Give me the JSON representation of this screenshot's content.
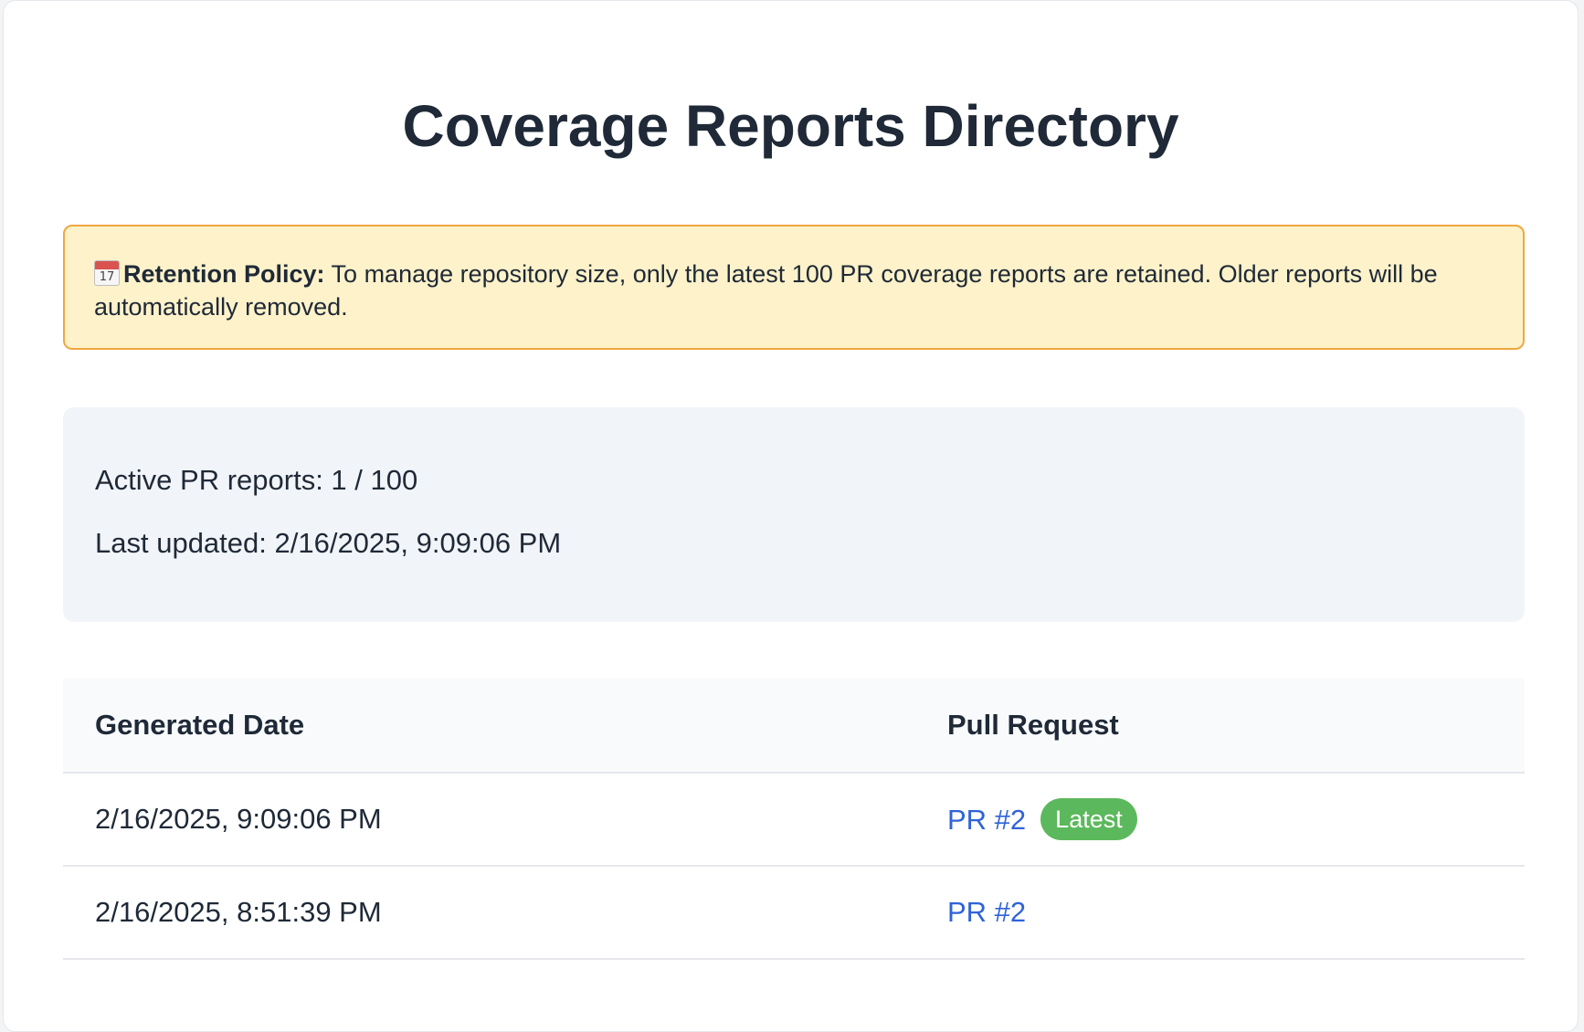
{
  "page": {
    "title": "Coverage Reports Directory"
  },
  "retention": {
    "icon": "calendar-icon",
    "icon_day": "17",
    "label": "Retention Policy:",
    "text": " To manage repository size, only the latest 100 PR coverage reports are retained. Older reports will be automatically removed."
  },
  "stats": {
    "active": "Active PR reports: 1 / 100",
    "updated": "Last updated: 2/16/2025, 9:09:06 PM"
  },
  "table": {
    "headers": [
      "Generated Date",
      "Pull Request"
    ],
    "rows": [
      {
        "date": "2/16/2025, 9:09:06 PM",
        "pr": "PR #2",
        "badge": "Latest"
      },
      {
        "date": "2/16/2025, 8:51:39 PM",
        "pr": "PR #2"
      }
    ]
  },
  "colors": {
    "title": "#1f2937",
    "retention_bg": "#fdf2c9",
    "retention_border": "#f0a741",
    "stats_bg": "#f1f5f9",
    "link": "#2f63d8",
    "badge_bg": "#5cb85c"
  }
}
